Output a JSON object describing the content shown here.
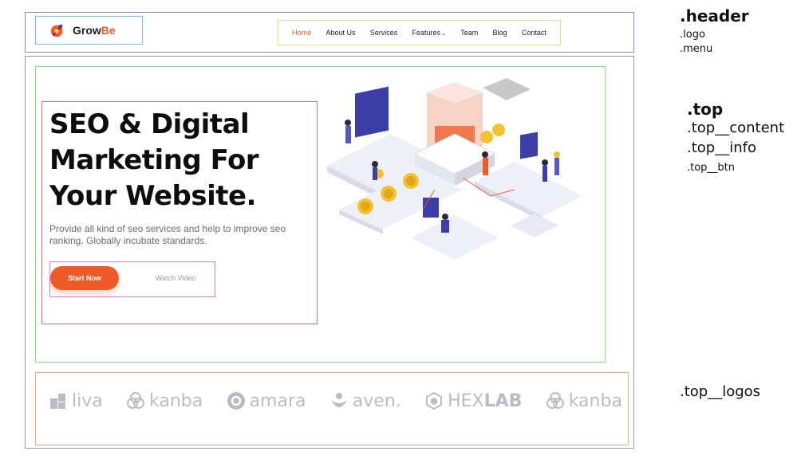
{
  "brand": {
    "name_part1": "Grow",
    "name_part2": "Be",
    "accent_color": "#f05a28"
  },
  "menu": {
    "items": [
      {
        "label": "Home",
        "active": true
      },
      {
        "label": "About Us"
      },
      {
        "label": "Services"
      },
      {
        "label": "Features",
        "has_dropdown": true
      },
      {
        "label": "Team"
      },
      {
        "label": "Blog"
      },
      {
        "label": "Contact"
      }
    ]
  },
  "hero": {
    "headline": "SEO & Digital Marketing For Your Website.",
    "description": "Provide all kind of seo services and help to improve seo ranking. Globally incubate standards.",
    "primary_button": "Start Now",
    "secondary_button": "Watch Video",
    "illustration_icon": "isometric-seo-illustration"
  },
  "logos": [
    {
      "name": "liva",
      "icon": "liva-logo-icon"
    },
    {
      "name": "kanba",
      "icon": "kanba-logo-icon"
    },
    {
      "name": "amara",
      "icon": "amara-logo-icon"
    },
    {
      "name": "aven.",
      "icon": "aven-logo-icon"
    },
    {
      "name_part1": "HEX",
      "name_part2": "LAB",
      "icon": "hexlab-logo-icon"
    },
    {
      "name": "kanba",
      "icon": "kanba-logo-icon"
    }
  ],
  "annotations": {
    "header": ".header",
    "logo": ".logo",
    "menu": ".menu",
    "top": ".top",
    "top_content": ".top__content",
    "top_info": ".top__info",
    "top_btn": ".top__btn",
    "top_logos": ".top__logos"
  },
  "colors": {
    "header_outline": "#8a84e8",
    "logo_outline": "#6cc6e8",
    "menu_outline": "#e8e17a",
    "content_outline": "#7ce07c",
    "info_outline": "#e26b6b",
    "btn_outline": "#e07ce0",
    "logos_outline": "#e0b07c",
    "logo_gray": "#b9bcc4"
  }
}
